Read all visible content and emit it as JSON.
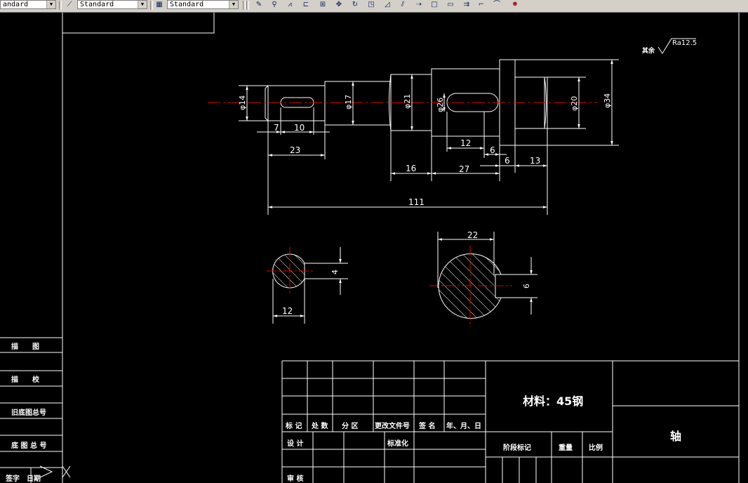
{
  "toolbar": {
    "text_style": "andard",
    "dim_style": "Standard",
    "table_style": "Standard",
    "icons": [
      "pencil-icon",
      "match-props-icon",
      "mirror-icon",
      "offset-icon",
      "array-icon",
      "move-icon",
      "rotate-icon",
      "scale-icon",
      "stretch-icon",
      "trim-icon",
      "extend-icon",
      "break-icon",
      "chamfer-icon",
      "fillet-icon",
      "explode-icon"
    ]
  },
  "drawing": {
    "surface_note": "其余",
    "roughness": "Ra12.5",
    "diameters": {
      "d14": "φ14",
      "d17": "φ17",
      "d21": "φ21",
      "d26": "φ26",
      "d20": "φ20",
      "d34": "φ34"
    },
    "dims": {
      "d7": "7",
      "d10": "10",
      "d23": "23",
      "d12": "12",
      "d6a": "6",
      "d6b": "6",
      "d13": "13",
      "d16": "16",
      "d27": "27",
      "d111": "111"
    },
    "section1": {
      "width": "12",
      "depth": "4"
    },
    "section2": {
      "width": "22",
      "depth": "6"
    }
  },
  "left_table": {
    "rows": [
      "描　　图",
      "描　　校",
      "旧底图总号",
      "底 图 总 号",
      "签字　日期"
    ]
  },
  "title_block": {
    "headers": [
      "标 记",
      "处 数",
      "分 区",
      "更改文件号",
      "签 名",
      "年、月、日"
    ],
    "design": "设 计",
    "standardize": "标准化",
    "review": "审 核",
    "material": "材料：45钢",
    "stage_mark": "阶段标记",
    "weight": "重量",
    "scale": "比例",
    "part_name": "轴"
  }
}
